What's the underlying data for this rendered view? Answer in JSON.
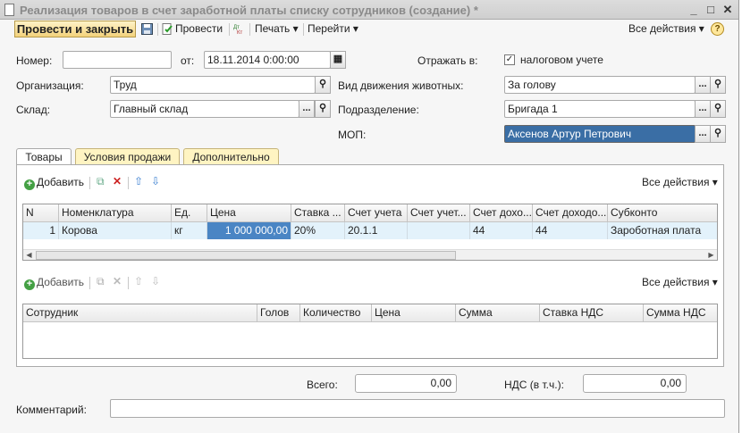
{
  "window": {
    "title": "Реализация товаров в счет заработной платы списку сотрудников (создание) *",
    "controls": {
      "minimize": "_",
      "maximize": "□",
      "close": "✕"
    }
  },
  "toolbar": {
    "post_close_label": "Провести и закрыть",
    "post_label": "Провести",
    "print_label": "Печать ▾",
    "goto_label": "Перейти ▾",
    "all_actions_label": "Все действия ▾",
    "help_label": "?"
  },
  "header": {
    "number_label": "Номер:",
    "number_value": "",
    "date_label": "от:",
    "date_value": "18.11.2014  0:00:00",
    "reflect_label": "Отражать в:",
    "tax_accounting_label": "налоговом учете",
    "tax_accounting_checked": true,
    "org_label": "Организация:",
    "org_value": "Труд",
    "movement_label": "Вид движения животных:",
    "movement_value": "За голову",
    "warehouse_label": "Склад:",
    "warehouse_value": "Главный склад",
    "division_label": "Подразделение:",
    "division_value": "Бригада 1",
    "mop_label": "МОП:",
    "mop_value": "Аксенов Артур Петрович"
  },
  "tabs": [
    {
      "label": "Товары",
      "active": true
    },
    {
      "label": "Условия продажи",
      "active": false
    },
    {
      "label": "Дополнительно",
      "active": false
    }
  ],
  "goods": {
    "add_label": "Добавить",
    "all_actions_label": "Все действия ▾",
    "columns": [
      "N",
      "Номенклатура",
      "Ед.",
      "Цена",
      "Ставка ...",
      "Счет учета",
      "Счет учет...",
      "Счет дохо...",
      "Счет доходо...",
      "Субконто"
    ],
    "rows": [
      [
        "1",
        "Корова",
        "кг",
        "1 000 000,00",
        "20%",
        "20.1.1",
        "",
        "44",
        "44",
        "Зароботная плата"
      ]
    ]
  },
  "employees": {
    "add_label": "Добавить",
    "all_actions_label": "Все действия ▾",
    "columns": [
      "Сотрудник",
      "Голов",
      "Количество",
      "Цена",
      "Сумма",
      "Ставка НДС",
      "Сумма НДС"
    ]
  },
  "totals": {
    "total_label": "Всего:",
    "total_value": "0,00",
    "vat_label": "НДС (в т.ч.):",
    "vat_value": "0,00"
  },
  "comment": {
    "label": "Комментарий:",
    "value": ""
  },
  "colors": {
    "accent": "#f3d27c",
    "selection": "#3a6ea5",
    "row_highlight": "#e3f2fb",
    "add_green": "#44a044"
  }
}
